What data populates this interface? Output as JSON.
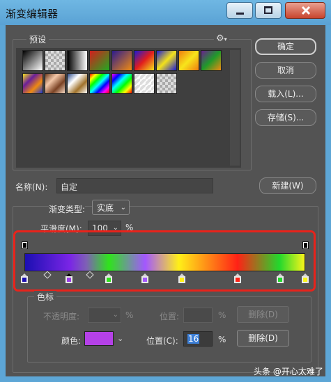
{
  "window": {
    "title": "渐变编辑器",
    "controls": {
      "minimize": "minimize-icon",
      "maximize": "maximize-icon",
      "close": "close-icon"
    }
  },
  "presets": {
    "label": "预设",
    "gear_icon": "gear-icon",
    "swatches": [
      {
        "name": "foreground-to-background",
        "style": "linear-gradient(135deg,#000,#fff)"
      },
      {
        "name": "foreground-to-transparent",
        "style": "checker-black"
      },
      {
        "name": "black-white",
        "style": "linear-gradient(to right,#000,#fff)"
      },
      {
        "name": "red-green",
        "style": "linear-gradient(135deg,#d31d1d,#21aa21)"
      },
      {
        "name": "violet-orange",
        "style": "linear-gradient(135deg,#2b1b8f,#f08b11)"
      },
      {
        "name": "blue-red-yellow",
        "style": "linear-gradient(135deg,#1a1ad6,#e11d1d,#f3e21b)"
      },
      {
        "name": "blue-yellow-blue",
        "style": "linear-gradient(135deg,#1a1ad6,#f3e21b,#1a1ad6)"
      },
      {
        "name": "orange-yellow-orange",
        "style": "linear-gradient(135deg,#ef7d10,#f7e51b,#ef7d10)"
      },
      {
        "name": "violet-green-orange",
        "style": "linear-gradient(135deg,#6a1f8f,#1f9a2a,#ef8a10)"
      },
      {
        "name": "yellow-violet-orange-blue",
        "style": "linear-gradient(135deg,#f5e31b,#6a1f9a,#ef8a10,#1a3ad6)"
      },
      {
        "name": "copper",
        "style": "linear-gradient(135deg,#6b3a1f,#f3c7a8,#7a4224,#f6d9c3)"
      },
      {
        "name": "chrome",
        "style": "linear-gradient(135deg,#2a4a8a,#fff,#a0722a,#fff)"
      },
      {
        "name": "spectrum",
        "style": "linear-gradient(135deg,#f00,#ff0,#0f0,#0ff,#00f,#f0f,#f00)"
      },
      {
        "name": "transparent-rainbow",
        "style": "linear-gradient(135deg,#f0f,#00f,#0ff,#0f0,#ff0,#f00)"
      },
      {
        "name": "transparent-stripes",
        "style": "checker-stripes"
      },
      {
        "name": "neutral-density",
        "style": "checker"
      }
    ]
  },
  "buttons": {
    "ok": "确定",
    "cancel": "取消",
    "load": "载入(L)...",
    "save": "存储(S)...",
    "new": "新建(W)"
  },
  "name_field": {
    "label": "名称(N):",
    "value": "自定"
  },
  "gradient_type": {
    "label": "渐变类型:",
    "value": "实底"
  },
  "smoothness": {
    "label": "平滑度(M):",
    "value": "100",
    "unit": "%"
  },
  "gradient_bar": {
    "opacity_stops": [
      {
        "location_pct": 0
      },
      {
        "location_pct": 100
      }
    ],
    "color_stops": [
      {
        "color": "#1b0fb2",
        "location_pct": 0
      },
      {
        "color": "#9b3ce6",
        "location_pct": 16,
        "selected": true
      },
      {
        "color": "#2fe31c",
        "location_pct": 30
      },
      {
        "color": "#a357ff",
        "location_pct": 43
      },
      {
        "color": "#ffef18",
        "location_pct": 56
      },
      {
        "color": "#ff2216",
        "location_pct": 76
      },
      {
        "color": "#22d82d",
        "location_pct": 91
      },
      {
        "color": "#f9f41a",
        "location_pct": 100
      }
    ],
    "midpoints_pct": [
      8,
      23
    ]
  },
  "stops_group": {
    "label": "色标",
    "opacity": {
      "label": "不透明度:",
      "unit": "%",
      "location_label": "位置:",
      "location_unit": "%",
      "delete": "删除(D)"
    },
    "color": {
      "label": "颜色:",
      "swatch_color": "#b541e8",
      "location_label": "位置(C):",
      "location_value": "16",
      "unit": "%",
      "delete": "删除(D)"
    }
  },
  "watermark": "头条 @开心太难了"
}
